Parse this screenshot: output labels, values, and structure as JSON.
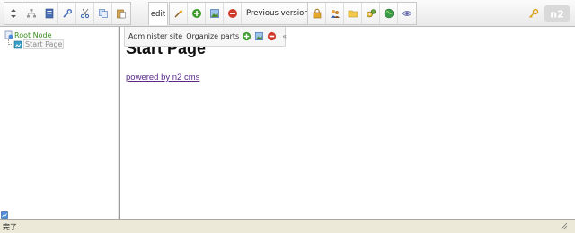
{
  "toolbar": {
    "edit_tab": "edit",
    "previous_versions_label": "Previous versions",
    "logo_text": "n2",
    "group1_icons": [
      "arrows-updown-icon",
      "tree-icon",
      "page-icon",
      "wrench-icon",
      "scissors-icon",
      "copy-icon",
      "paste-icon"
    ],
    "group2_icons": [
      "magic-wand-icon",
      "add-icon",
      "edit-image-icon",
      "delete-icon"
    ],
    "group3_icons": [
      "lock-icon",
      "users-icon",
      "folder-icon",
      "cog-icon",
      "globe-icon",
      "eye-icon"
    ],
    "key_icon": "key-icon"
  },
  "tree": {
    "root_label": "Root Node",
    "child_label": "Start Page"
  },
  "admin_bar": {
    "administer_label": "Administer site",
    "organize_label": "Organize parts",
    "collapse_glyph": "«"
  },
  "content": {
    "heading": "Start Page",
    "link_text": "powered by n2 cms"
  },
  "status": {
    "text": "完了"
  },
  "colors": {
    "tree_root": "#3a8f1e",
    "link": "#5a2a8a",
    "add_green": "#3c9b2c",
    "delete_red": "#d13a2a"
  }
}
